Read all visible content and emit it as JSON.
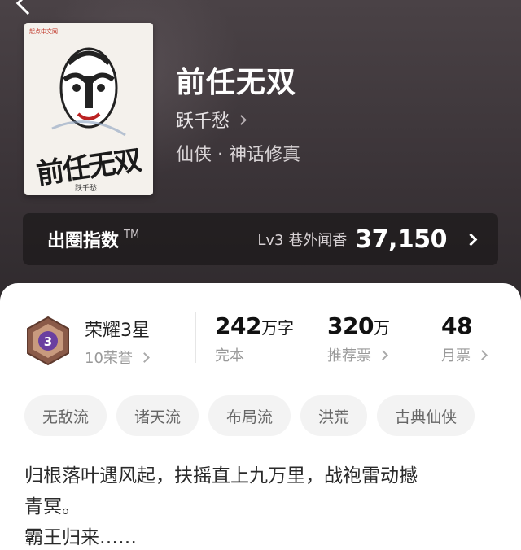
{
  "book": {
    "title": "前任无双",
    "author": "跃千愁",
    "genre": "仙侠 · 神话修真",
    "cover": {
      "title": "前任无双",
      "author_credit": "跃千愁",
      "publisher_badge": "起点中文网"
    }
  },
  "influence": {
    "label": "出圈指数",
    "tm": "TM",
    "level": "Lv3 巷外闻香",
    "score": "37,150"
  },
  "honor": {
    "badge_level": "3",
    "title": "荣耀3星",
    "count": "10荣誉"
  },
  "stats": [
    {
      "value": "242",
      "unit": "万字",
      "label": "完本"
    },
    {
      "value": "320",
      "unit": "万",
      "label": "推荐票"
    },
    {
      "value": "48",
      "unit": "",
      "label": "月票"
    }
  ],
  "tags": [
    "无敌流",
    "诸天流",
    "布局流",
    "洪荒",
    "古典仙侠"
  ],
  "synopsis": {
    "line1": "归根落叶遇风起，扶摇直上九万里，战袍雷动撼",
    "line2": "青冥。",
    "line3": "霸王归来……"
  },
  "colors": {
    "hero_bg": "#3b3438",
    "badge_purple": "#6a3fa0",
    "badge_frame": "#8a5a48"
  }
}
